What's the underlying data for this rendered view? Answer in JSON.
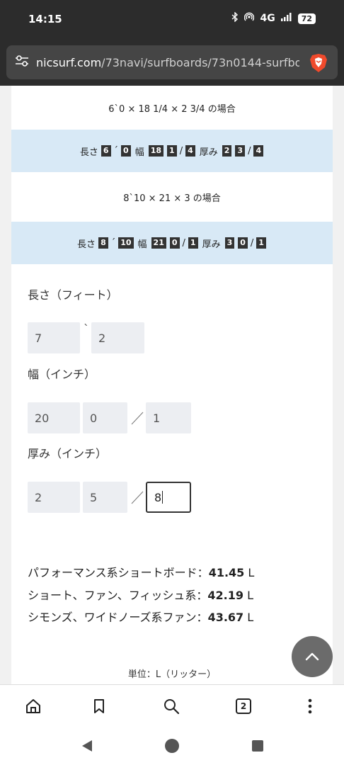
{
  "status": {
    "time": "14:15",
    "network": "4G",
    "battery": "72"
  },
  "browser": {
    "url_domain": "nicsurf.com",
    "url_path": "/73navi/surfboards/73n0144-surfboa",
    "tab_count": "2"
  },
  "examples": [
    {
      "caption": "6`0 × 18 1/4 × 2 3/4 の場合",
      "length_label": "長さ",
      "length_ft": "6",
      "length_tick": "´",
      "length_in": "0",
      "width_label": "幅",
      "width_whole": "18",
      "width_num": "1",
      "width_sep": "/",
      "width_den": "4",
      "thick_label": "厚み",
      "thick_whole": "2",
      "thick_num": "3",
      "thick_sep": "/",
      "thick_den": "4"
    },
    {
      "caption": "8`10 × 21 × 3 の場合",
      "length_label": "長さ",
      "length_ft": "8",
      "length_tick": "´",
      "length_in": "10",
      "width_label": "幅",
      "width_whole": "21",
      "width_num": "0",
      "width_sep": "/",
      "width_den": "1",
      "thick_label": "厚み",
      "thick_whole": "3",
      "thick_num": "0",
      "thick_sep": "/",
      "thick_den": "1"
    }
  ],
  "form": {
    "length_label": "長さ（フィート）",
    "length_ft": "7",
    "length_tick": "`",
    "length_in": "2",
    "width_label": "幅（インチ）",
    "width_whole": "20",
    "width_num": "0",
    "width_den": "1",
    "thick_label": "厚み（インチ）",
    "thick_whole": "2",
    "thick_num": "5",
    "thick_den": "8"
  },
  "results": [
    {
      "label": "パフォーマンス系ショートボード：",
      "value": "41.45",
      "unit": " L"
    },
    {
      "label": "ショート、ファン、フィッシュ系：",
      "value": "42.19",
      "unit": " L"
    },
    {
      "label": "シモンズ、ワイドノーズ系ファン：",
      "value": "43.67",
      "unit": " L"
    }
  ],
  "unit_note": "単位：L（リッター）"
}
